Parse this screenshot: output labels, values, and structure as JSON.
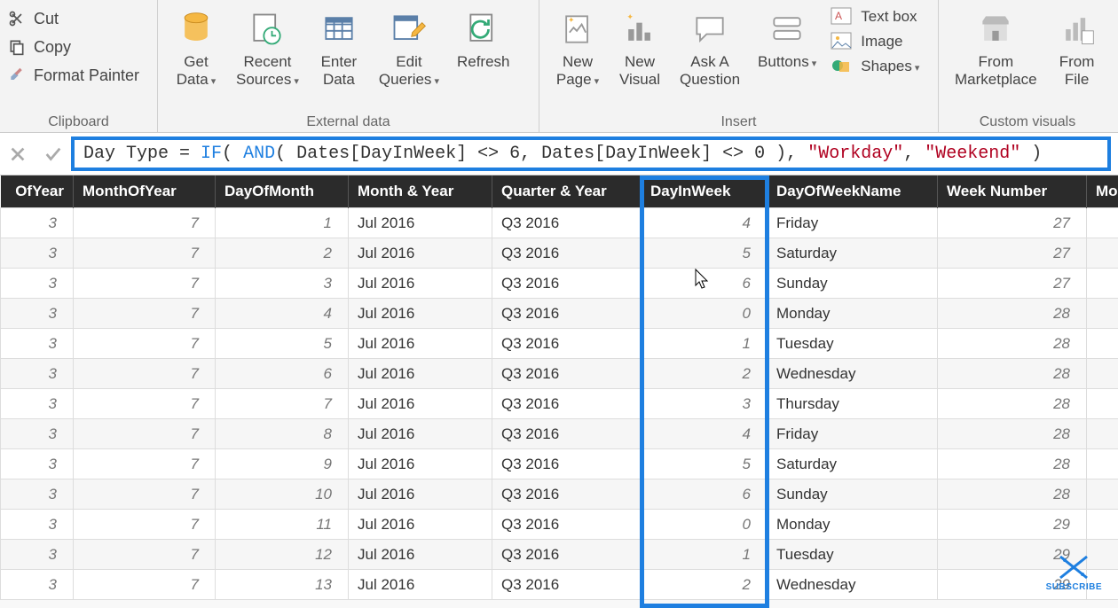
{
  "ribbon": {
    "clipboard": {
      "label": "Clipboard",
      "cut": "Cut",
      "copy": "Copy",
      "format_painter": "Format Painter"
    },
    "external_data": {
      "label": "External data",
      "get_data": "Get\nData",
      "recent_sources": "Recent\nSources",
      "enter_data": "Enter\nData",
      "edit_queries": "Edit\nQueries",
      "refresh": "Refresh"
    },
    "insert": {
      "label": "Insert",
      "new_page": "New\nPage",
      "new_visual": "New\nVisual",
      "ask_question": "Ask A\nQuestion",
      "buttons": "Buttons",
      "text_box": "Text box",
      "image": "Image",
      "shapes": "Shapes"
    },
    "custom_visuals": {
      "label": "Custom visuals",
      "from_marketplace": "From\nMarketplace",
      "from_file": "From\nFile"
    }
  },
  "formula": {
    "prefix": "Day Type = ",
    "kw_if": "IF",
    "paren1": "( ",
    "kw_and": "AND",
    "mid": "( Dates[DayInWeek] <> 6, Dates[DayInWeek] <> 0 ), ",
    "str1": "\"Workday\"",
    "sep": ", ",
    "str2": "\"Weekend\"",
    "end": " )"
  },
  "columns": [
    "OfYear",
    "MonthOfYear",
    "DayOfMonth",
    "Month & Year",
    "Quarter & Year",
    "DayInWeek",
    "DayOfWeekName",
    "Week Number",
    "Mo"
  ],
  "rows": [
    {
      "ofYear": 3,
      "monthOfYear": 7,
      "dayOfMonth": 1,
      "monthYear": "Jul 2016",
      "quarterYear": "Q3 2016",
      "dayInWeek": 4,
      "dayName": "Friday",
      "weekNum": 27
    },
    {
      "ofYear": 3,
      "monthOfYear": 7,
      "dayOfMonth": 2,
      "monthYear": "Jul 2016",
      "quarterYear": "Q3 2016",
      "dayInWeek": 5,
      "dayName": "Saturday",
      "weekNum": 27
    },
    {
      "ofYear": 3,
      "monthOfYear": 7,
      "dayOfMonth": 3,
      "monthYear": "Jul 2016",
      "quarterYear": "Q3 2016",
      "dayInWeek": 6,
      "dayName": "Sunday",
      "weekNum": 27
    },
    {
      "ofYear": 3,
      "monthOfYear": 7,
      "dayOfMonth": 4,
      "monthYear": "Jul 2016",
      "quarterYear": "Q3 2016",
      "dayInWeek": 0,
      "dayName": "Monday",
      "weekNum": 28
    },
    {
      "ofYear": 3,
      "monthOfYear": 7,
      "dayOfMonth": 5,
      "monthYear": "Jul 2016",
      "quarterYear": "Q3 2016",
      "dayInWeek": 1,
      "dayName": "Tuesday",
      "weekNum": 28
    },
    {
      "ofYear": 3,
      "monthOfYear": 7,
      "dayOfMonth": 6,
      "monthYear": "Jul 2016",
      "quarterYear": "Q3 2016",
      "dayInWeek": 2,
      "dayName": "Wednesday",
      "weekNum": 28
    },
    {
      "ofYear": 3,
      "monthOfYear": 7,
      "dayOfMonth": 7,
      "monthYear": "Jul 2016",
      "quarterYear": "Q3 2016",
      "dayInWeek": 3,
      "dayName": "Thursday",
      "weekNum": 28
    },
    {
      "ofYear": 3,
      "monthOfYear": 7,
      "dayOfMonth": 8,
      "monthYear": "Jul 2016",
      "quarterYear": "Q3 2016",
      "dayInWeek": 4,
      "dayName": "Friday",
      "weekNum": 28
    },
    {
      "ofYear": 3,
      "monthOfYear": 7,
      "dayOfMonth": 9,
      "monthYear": "Jul 2016",
      "quarterYear": "Q3 2016",
      "dayInWeek": 5,
      "dayName": "Saturday",
      "weekNum": 28
    },
    {
      "ofYear": 3,
      "monthOfYear": 7,
      "dayOfMonth": 10,
      "monthYear": "Jul 2016",
      "quarterYear": "Q3 2016",
      "dayInWeek": 6,
      "dayName": "Sunday",
      "weekNum": 28
    },
    {
      "ofYear": 3,
      "monthOfYear": 7,
      "dayOfMonth": 11,
      "monthYear": "Jul 2016",
      "quarterYear": "Q3 2016",
      "dayInWeek": 0,
      "dayName": "Monday",
      "weekNum": 29
    },
    {
      "ofYear": 3,
      "monthOfYear": 7,
      "dayOfMonth": 12,
      "monthYear": "Jul 2016",
      "quarterYear": "Q3 2016",
      "dayInWeek": 1,
      "dayName": "Tuesday",
      "weekNum": 29
    },
    {
      "ofYear": 3,
      "monthOfYear": 7,
      "dayOfMonth": 13,
      "monthYear": "Jul 2016",
      "quarterYear": "Q3 2016",
      "dayInWeek": 2,
      "dayName": "Wednesday",
      "weekNum": 29
    }
  ],
  "highlight_column_index": 5,
  "subscribe_label": "SUBSCRIBE"
}
